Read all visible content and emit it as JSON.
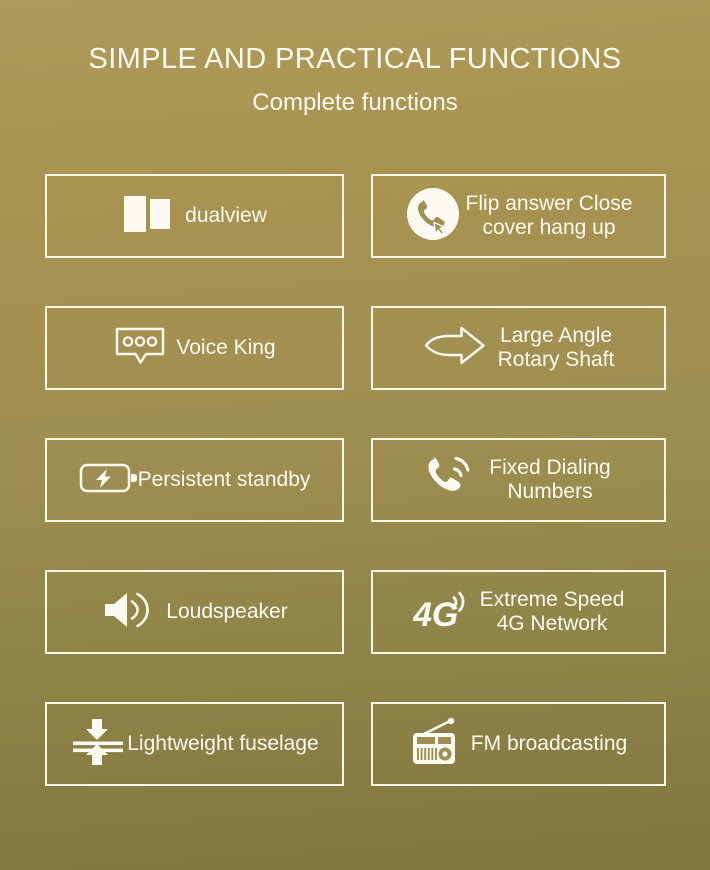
{
  "header": {
    "title": "SIMPLE AND PRACTICAL FUNCTIONS",
    "subtitle": "Complete functions"
  },
  "colors": {
    "background_top": "#af9a59",
    "background_bottom": "#827640",
    "border": "#fbf7e9",
    "text": "#fdfaf1"
  },
  "features": [
    {
      "icon": "dualview-icon",
      "label": "dualview"
    },
    {
      "icon": "flip-answer-phone-icon",
      "label": "Flip answer Close\ncover hang up"
    },
    {
      "icon": "speech-bubble-icon",
      "label": "Voice King"
    },
    {
      "icon": "curved-arrow-icon",
      "label": "Large Angle\nRotary Shaft"
    },
    {
      "icon": "battery-bolt-icon",
      "label": "Persistent standby"
    },
    {
      "icon": "dialing-phone-icon",
      "label": "Fixed Dialing\nNumbers"
    },
    {
      "icon": "loudspeaker-icon",
      "label": "Loudspeaker"
    },
    {
      "icon": "four-g-signal-icon",
      "label": "Extreme Speed\n4G Network"
    },
    {
      "icon": "compress-arrows-icon",
      "label": "Lightweight fuselage"
    },
    {
      "icon": "radio-icon",
      "label": "FM broadcasting"
    }
  ]
}
